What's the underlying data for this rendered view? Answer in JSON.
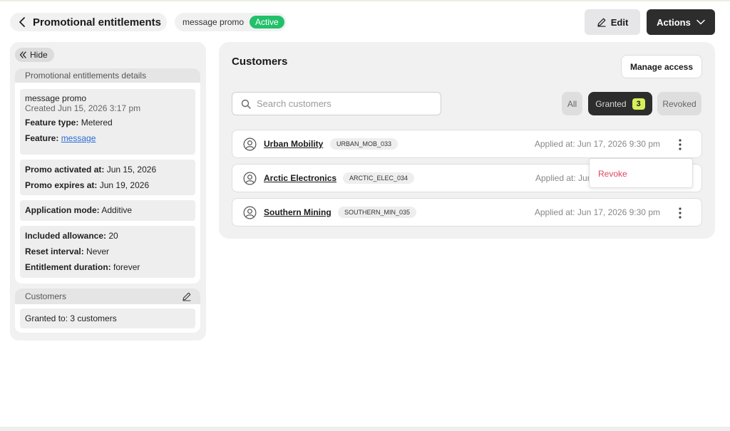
{
  "header": {
    "title": "Promotional entitlements",
    "promo_name": "message promo",
    "status": "Active",
    "edit_label": "Edit",
    "actions_label": "Actions"
  },
  "sidebar": {
    "hide_label": "Hide",
    "details": {
      "header": "Promotional entitlements details",
      "promo_name": "message promo",
      "created": "Created Jun 15, 2026 3:17 pm",
      "feature_type_label": "Feature type:",
      "feature_type_value": "Metered",
      "feature_label": "Feature:",
      "feature_value": "message",
      "promo_activated_label": "Promo activated at:",
      "promo_activated_value": "Jun 15, 2026",
      "promo_expires_label": "Promo expires at:",
      "promo_expires_value": "Jun 19, 2026",
      "application_mode_label": "Application mode:",
      "application_mode_value": "Additive",
      "included_allowance_label": "Included allowance:",
      "included_allowance_value": "20",
      "reset_interval_label": "Reset interval:",
      "reset_interval_value": "Never",
      "entitlement_duration_label": "Entitlement duration:",
      "entitlement_duration_value": "forever"
    },
    "customers": {
      "header": "Customers",
      "granted_text": "Granted to: 3 customers"
    }
  },
  "main": {
    "title": "Customers",
    "manage_access_label": "Manage access",
    "search_placeholder": "Search customers",
    "filters": {
      "all": "All",
      "granted": "Granted",
      "granted_count": "3",
      "revoked": "Revoked"
    },
    "rows": [
      {
        "name": "Urban Mobility",
        "code": "URBAN_MOB_033",
        "applied": "Applied at: Jun 17, 2026 9:30 pm"
      },
      {
        "name": "Arctic Electronics",
        "code": "ARCTIC_ELEC_034",
        "applied": "Applied at: Jun"
      },
      {
        "name": "Southern Mining",
        "code": "SOUTHERN_MIN_035",
        "applied": "Applied at: Jun 17, 2026 9:30 pm"
      }
    ],
    "menu": {
      "revoke_label": "Revoke"
    }
  },
  "colors": {
    "active_badge": "#22c06a",
    "dark_button": "#2d2d2d",
    "count_badge": "#d7f05a",
    "revoke": "#e0465f",
    "link": "#2a6bd8"
  },
  "icons": [
    "chevron-left-icon",
    "pencil-icon",
    "chevron-down-icon",
    "double-chevron-left-icon",
    "search-icon",
    "user-circle-icon",
    "kebab-menu-icon"
  ]
}
